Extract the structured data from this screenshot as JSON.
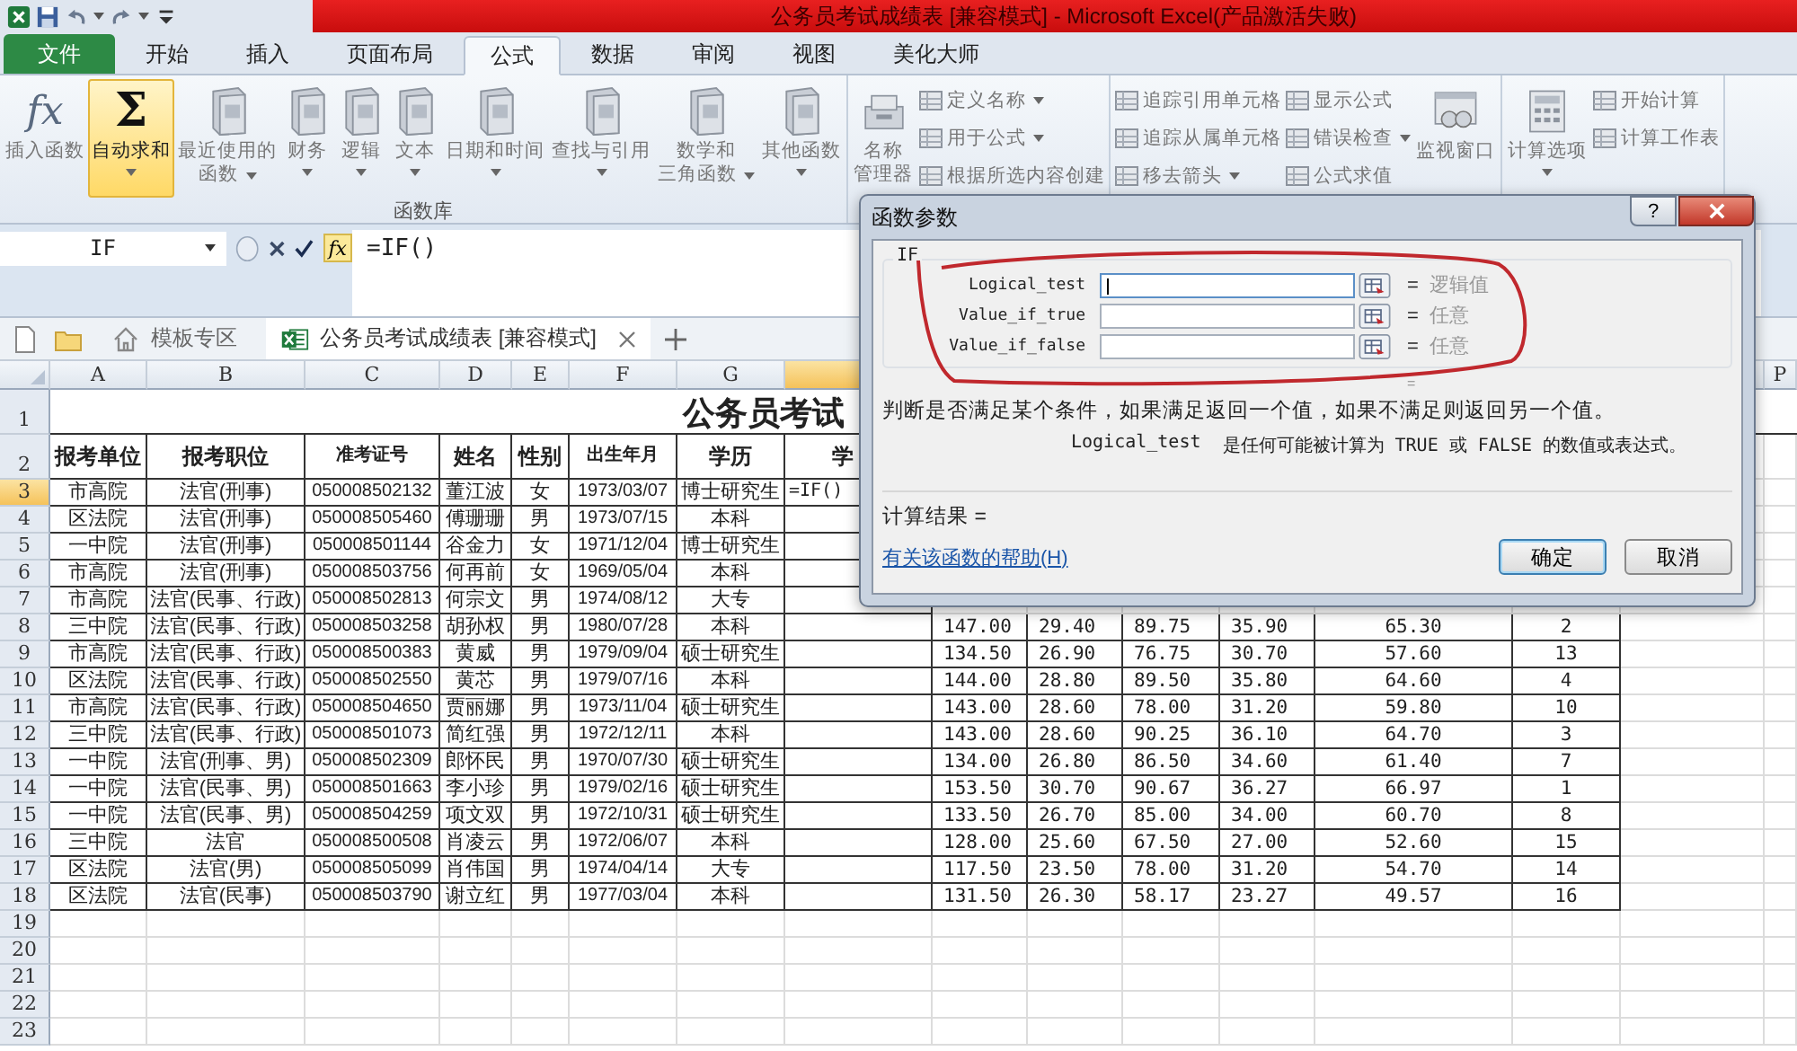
{
  "title_bar": {
    "title": "公务员考试成绩表  [兼容模式]  -  Microsoft Excel(产品激活失败)"
  },
  "ribbon_tabs": [
    {
      "label": "文件",
      "kind": "file",
      "selected": false
    },
    {
      "label": "开始",
      "kind": "tab",
      "selected": false
    },
    {
      "label": "插入",
      "kind": "tab",
      "selected": false
    },
    {
      "label": "页面布局",
      "kind": "tab",
      "selected": false
    },
    {
      "label": "公式",
      "kind": "tab",
      "selected": true
    },
    {
      "label": "数据",
      "kind": "tab",
      "selected": false
    },
    {
      "label": "审阅",
      "kind": "tab",
      "selected": false
    },
    {
      "label": "视图",
      "kind": "tab",
      "selected": false
    },
    {
      "label": "美化大师",
      "kind": "tab",
      "selected": false
    }
  ],
  "ribbon_groups": [
    {
      "label": "函数库",
      "items": [
        {
          "kind": "big",
          "lines": [
            "插入函数"
          ],
          "icon_text": "fx",
          "dropdown": false,
          "disabled": true,
          "highlighted": false
        },
        {
          "kind": "big",
          "lines": [
            "自动求和"
          ],
          "icon_text": "Σ",
          "dropdown": true,
          "disabled": false,
          "highlighted": true
        },
        {
          "kind": "big",
          "lines": [
            "最近使用的",
            "函数"
          ],
          "dropdown": true,
          "disabled": true,
          "highlighted": false
        },
        {
          "kind": "big",
          "lines": [
            "财务"
          ],
          "dropdown": true,
          "disabled": true,
          "highlighted": false
        },
        {
          "kind": "big",
          "lines": [
            "逻辑"
          ],
          "dropdown": true,
          "disabled": true,
          "highlighted": false
        },
        {
          "kind": "big",
          "lines": [
            "文本"
          ],
          "dropdown": true,
          "disabled": true,
          "highlighted": false
        },
        {
          "kind": "big",
          "lines": [
            "日期和时间"
          ],
          "dropdown": true,
          "disabled": true,
          "highlighted": false
        },
        {
          "kind": "big",
          "lines": [
            "查找与引用"
          ],
          "dropdown": true,
          "disabled": true,
          "highlighted": false
        },
        {
          "kind": "big",
          "lines": [
            "数学和",
            "三角函数"
          ],
          "dropdown": true,
          "disabled": true,
          "highlighted": false
        },
        {
          "kind": "big",
          "lines": [
            "其他函数"
          ],
          "dropdown": true,
          "disabled": true,
          "highlighted": false
        }
      ]
    },
    {
      "items": [
        {
          "kind": "big",
          "lines": [
            "名称",
            "管理器"
          ],
          "dropdown": false,
          "disabled": true,
          "highlighted": false
        },
        {
          "kind": "stack",
          "buttons": [
            {
              "label": "定义名称",
              "dropdown": true,
              "disabled": true
            },
            {
              "label": "用于公式",
              "dropdown": true,
              "disabled": true
            },
            {
              "label": "根据所选内容创建",
              "dropdown": false,
              "disabled": true
            }
          ]
        }
      ]
    },
    {
      "items": [
        {
          "kind": "stack",
          "buttons": [
            {
              "label": "追踪引用单元格",
              "dropdown": false,
              "disabled": true
            },
            {
              "label": "追踪从属单元格",
              "dropdown": false,
              "disabled": true
            },
            {
              "label": "移去箭头",
              "dropdown": true,
              "disabled": true
            }
          ]
        },
        {
          "kind": "stack",
          "buttons": [
            {
              "label": "显示公式",
              "dropdown": false,
              "disabled": true
            },
            {
              "label": "错误检查",
              "dropdown": true,
              "disabled": true
            },
            {
              "label": "公式求值",
              "dropdown": false,
              "disabled": true
            }
          ]
        },
        {
          "kind": "big",
          "lines": [
            "监视窗口"
          ],
          "dropdown": false,
          "disabled": true,
          "highlighted": false
        }
      ]
    },
    {
      "items": [
        {
          "kind": "big",
          "lines": [
            "计算选项"
          ],
          "dropdown": true,
          "disabled": true,
          "highlighted": false
        },
        {
          "kind": "stack",
          "buttons": [
            {
              "label": "开始计算",
              "dropdown": false,
              "disabled": true
            },
            {
              "label": "计算工作表",
              "dropdown": false,
              "disabled": true
            }
          ]
        }
      ]
    }
  ],
  "formula_bar": {
    "name_box": "IF",
    "fx_label": "fx",
    "formula": "=IF()"
  },
  "doc_tabs": [
    {
      "label": "模板专区",
      "kind": "home",
      "selected": false
    },
    {
      "label": "公务员考试成绩表  [兼容模式]",
      "kind": "sheet",
      "selected": true
    }
  ],
  "grid": {
    "columns_left": [
      {
        "label": "A",
        "selected": false
      },
      {
        "label": "B",
        "selected": false
      },
      {
        "label": "C",
        "selected": false
      },
      {
        "label": "D",
        "selected": false
      },
      {
        "label": "E",
        "selected": false
      },
      {
        "label": "F",
        "selected": false
      },
      {
        "label": "G",
        "selected": false
      },
      {
        "selected": true
      }
    ],
    "columns_right": [
      {
        "label": "P",
        "selected": false
      }
    ],
    "rows": [
      {
        "num": "1",
        "selected": false,
        "kind": "title",
        "title": "公务员考试"
      },
      {
        "num": "2",
        "selected": false,
        "kind": "header",
        "cells": [
          "报考单位",
          "报考职位",
          "准考证号",
          "姓名",
          "性别",
          "出生年月",
          "学历"
        ],
        "col_h": "学"
      },
      {
        "num": "3",
        "selected": true,
        "kind": "data",
        "cells": [
          "市高院",
          "法官(刑事)",
          "050008502132",
          "董江波",
          "女",
          "1973/03/07",
          "博士研究生"
        ],
        "col_h": "=IF()"
      },
      {
        "num": "4",
        "selected": false,
        "kind": "data",
        "cells": [
          "区法院",
          "法官(刑事)",
          "050008505460",
          "傅珊珊",
          "男",
          "1973/07/15",
          "本科"
        ]
      },
      {
        "num": "5",
        "selected": false,
        "kind": "data",
        "cells": [
          "一中院",
          "法官(刑事)",
          "050008501144",
          "谷金力",
          "女",
          "1971/12/04",
          "博士研究生"
        ]
      },
      {
        "num": "6",
        "selected": false,
        "kind": "data",
        "cells": [
          "市高院",
          "法官(刑事)",
          "050008503756",
          "何再前",
          "女",
          "1969/05/04",
          "本科"
        ]
      },
      {
        "num": "7",
        "selected": false,
        "kind": "data",
        "cells": [
          "市高院",
          "法官(民事、行政)",
          "050008502813",
          "何宗文",
          "男",
          "1974/08/12",
          "大专"
        ]
      },
      {
        "num": "8",
        "selected": false,
        "kind": "data",
        "cells": [
          "三中院",
          "法官(民事、行政)",
          "050008503258",
          "胡孙权",
          "男",
          "1980/07/28",
          "本科"
        ],
        "scores": [
          "147.00",
          "29.40",
          "89.75",
          "35.90",
          "65.30",
          "2"
        ]
      },
      {
        "num": "9",
        "selected": false,
        "kind": "data",
        "cells": [
          "市高院",
          "法官(民事、行政)",
          "050008500383",
          "黄威",
          "男",
          "1979/09/04",
          "硕士研究生"
        ],
        "scores": [
          "134.50",
          "26.90",
          "76.75",
          "30.70",
          "57.60",
          "13"
        ]
      },
      {
        "num": "10",
        "selected": false,
        "kind": "data",
        "cells": [
          "区法院",
          "法官(民事、行政)",
          "050008502550",
          "黄芯",
          "男",
          "1979/07/16",
          "本科"
        ],
        "scores": [
          "144.00",
          "28.80",
          "89.50",
          "35.80",
          "64.60",
          "4"
        ]
      },
      {
        "num": "11",
        "selected": false,
        "kind": "data",
        "cells": [
          "市高院",
          "法官(民事、行政)",
          "050008504650",
          "贾丽娜",
          "男",
          "1973/11/04",
          "硕士研究生"
        ],
        "scores": [
          "143.00",
          "28.60",
          "78.00",
          "31.20",
          "59.80",
          "10"
        ]
      },
      {
        "num": "12",
        "selected": false,
        "kind": "data",
        "cells": [
          "三中院",
          "法官(民事、行政)",
          "050008501073",
          "简红强",
          "男",
          "1972/12/11",
          "本科"
        ],
        "scores": [
          "143.00",
          "28.60",
          "90.25",
          "36.10",
          "64.70",
          "3"
        ]
      },
      {
        "num": "13",
        "selected": false,
        "kind": "data",
        "cells": [
          "一中院",
          "法官(刑事、男)",
          "050008502309",
          "郎怀民",
          "男",
          "1970/07/30",
          "硕士研究生"
        ],
        "scores": [
          "134.00",
          "26.80",
          "86.50",
          "34.60",
          "61.40",
          "7"
        ]
      },
      {
        "num": "14",
        "selected": false,
        "kind": "data",
        "cells": [
          "一中院",
          "法官(民事、男)",
          "050008501663",
          "李小珍",
          "男",
          "1979/02/16",
          "硕士研究生"
        ],
        "scores": [
          "153.50",
          "30.70",
          "90.67",
          "36.27",
          "66.97",
          "1"
        ]
      },
      {
        "num": "15",
        "selected": false,
        "kind": "data",
        "cells": [
          "一中院",
          "法官(民事、男)",
          "050008504259",
          "项文双",
          "男",
          "1972/10/31",
          "硕士研究生"
        ],
        "scores": [
          "133.50",
          "26.70",
          "85.00",
          "34.00",
          "60.70",
          "8"
        ]
      },
      {
        "num": "16",
        "selected": false,
        "kind": "data",
        "cells": [
          "三中院",
          "法官",
          "050008500508",
          "肖凌云",
          "男",
          "1972/06/07",
          "本科"
        ],
        "scores": [
          "128.00",
          "25.60",
          "67.50",
          "27.00",
          "52.60",
          "15"
        ]
      },
      {
        "num": "17",
        "selected": false,
        "kind": "data",
        "cells": [
          "区法院",
          "法官(男)",
          "050008505099",
          "肖伟国",
          "男",
          "1974/04/14",
          "大专"
        ],
        "scores": [
          "117.50",
          "23.50",
          "78.00",
          "31.20",
          "54.70",
          "14"
        ]
      },
      {
        "num": "18",
        "selected": false,
        "kind": "data",
        "cells": [
          "区法院",
          "法官(民事)",
          "050008503790",
          "谢立红",
          "男",
          "1977/03/04",
          "本科"
        ],
        "scores": [
          "131.50",
          "26.30",
          "58.17",
          "23.27",
          "49.57",
          "16"
        ]
      },
      {
        "num": "19",
        "selected": false,
        "kind": "empty"
      },
      {
        "num": "20",
        "selected": false,
        "kind": "empty"
      },
      {
        "num": "21",
        "selected": false,
        "kind": "empty"
      },
      {
        "num": "22",
        "selected": false,
        "kind": "empty"
      },
      {
        "num": "23",
        "selected": false,
        "kind": "empty"
      }
    ]
  },
  "dialog": {
    "title": "函数参数",
    "help_button": "?",
    "function": "IF",
    "args": [
      {
        "name": "Logical_test",
        "sign": "=",
        "hint": "逻辑值",
        "focused": true
      },
      {
        "name": "Value_if_true",
        "sign": "=",
        "hint": "任意",
        "focused": false
      },
      {
        "name": "Value_if_false",
        "sign": "=",
        "hint": "任意",
        "focused": false
      }
    ],
    "function_result": "=",
    "description": "判断是否满足某个条件，如果满足返回一个值，如果不满足则返回另一个值。",
    "arg_help": {
      "name": "Logical_test",
      "text": "是任何可能被计算为 TRUE 或 FALSE 的数值或表达式。"
    },
    "result_label": "计算结果 =",
    "help_link": "有关该函数的帮助(H)",
    "buttons": [
      {
        "label": "确定",
        "default": true
      },
      {
        "label": "取消",
        "default": false
      }
    ]
  }
}
